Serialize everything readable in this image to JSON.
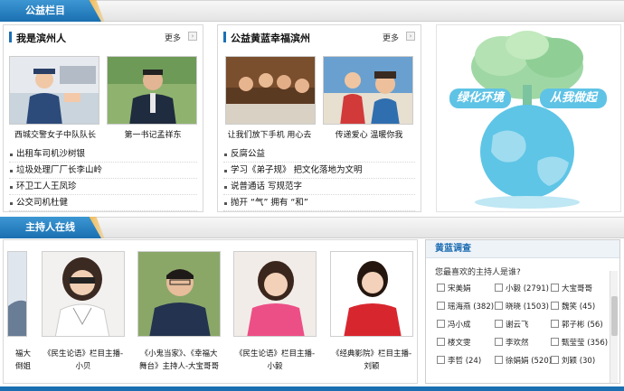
{
  "sections": {
    "charity_label": "公益栏目",
    "hosts_label": "主持人在线"
  },
  "panel_left": {
    "title": "我是滨州人",
    "more": "更多",
    "captions": [
      "西城交警女子中队队长",
      "第一书记孟祥东"
    ],
    "items": [
      "出租车司机沙树银",
      "垃圾处理厂厂长李山岭",
      "环卫工人王凤珍",
      "公交司机杜健"
    ]
  },
  "panel_mid": {
    "title": "公益黄蓝幸福滨州",
    "more": "更多",
    "captions": [
      "让我们放下手机 用心去",
      "传递爱心 温暖你我"
    ],
    "items": [
      "反腐公益",
      "学习《弟子规》 把文化落地为文明",
      "说普通话 写规范字",
      "抛开 “气” 拥有 “和”"
    ]
  },
  "poster": {
    "slogan_left": "绿化环境",
    "slogan_right": "从我做起"
  },
  "hosts": [
    {
      "line1": "福大",
      "line2": "倒姐"
    },
    {
      "line1": "《民生论语》栏目主播-",
      "line2": "小贝"
    },
    {
      "line1": "《小鬼当家》、《幸福大",
      "line2": "舞台》主持人-大宝哥哥"
    },
    {
      "line1": "《民生论语》栏目主播-",
      "line2": "小毅"
    },
    {
      "line1": "《经典影院》栏目主播-",
      "line2": "刘颖"
    }
  ],
  "survey": {
    "title": "黄蓝调查",
    "question": "您最喜欢的主持人是谁?",
    "options": [
      [
        "宋美娟",
        "小毅 (2791)",
        "大宝哥哥"
      ],
      [
        "瑶海燕 (382)",
        "晓晓 (1503)",
        "魏笑 (45)"
      ],
      [
        "冯小成",
        "谢云飞",
        "郭子彬 (56)"
      ],
      [
        "楼文雯",
        "李欢然",
        "甄莹莹 (356)"
      ],
      [
        "李哲 (24)",
        "徐娟娟 (520)",
        "刘颖 (30)"
      ]
    ]
  }
}
